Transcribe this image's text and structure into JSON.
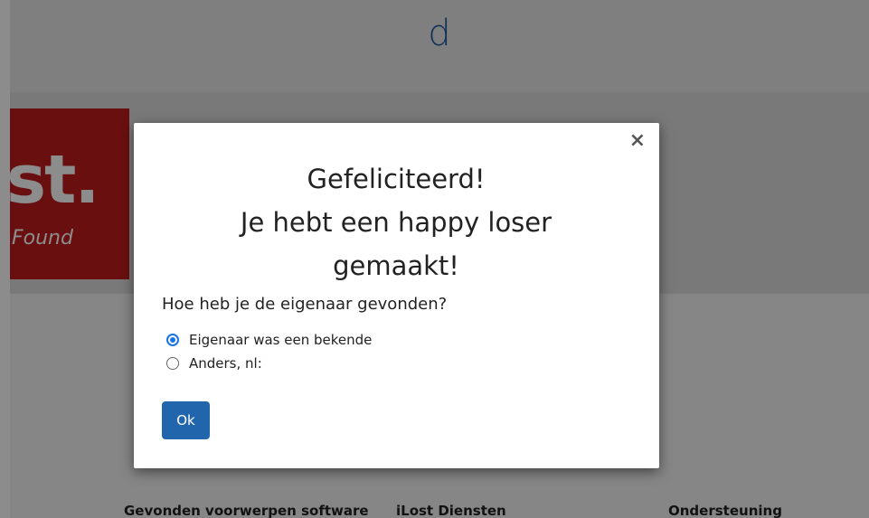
{
  "header": {
    "site_letter": "d"
  },
  "logo": {
    "text_main": "st.",
    "text_sub": "Found"
  },
  "footer": {
    "columns": [
      {
        "label": "Gevonden voorwerpen software"
      },
      {
        "label": "iLost Diensten"
      },
      {
        "label": "Ondersteuning"
      }
    ]
  },
  "modal": {
    "close_symbol": "×",
    "title_line1": "Gefeliciteerd!",
    "title_line2": "Je hebt een happy loser",
    "title_line3": "gemaakt!",
    "question": "Hoe heb je de eigenaar gevonden?",
    "options": [
      {
        "label": "Eigenaar was een bekende",
        "checked": true
      },
      {
        "label": "Anders, nl:",
        "checked": false
      }
    ],
    "ok_label": "Ok"
  },
  "colors": {
    "accent": "#1a73e8",
    "button": "#2166ac",
    "logo_red": "#c21c1c",
    "header_text": "#1f5aa0"
  },
  "icons": {
    "close": "close-icon",
    "radio": "radio-icon"
  }
}
